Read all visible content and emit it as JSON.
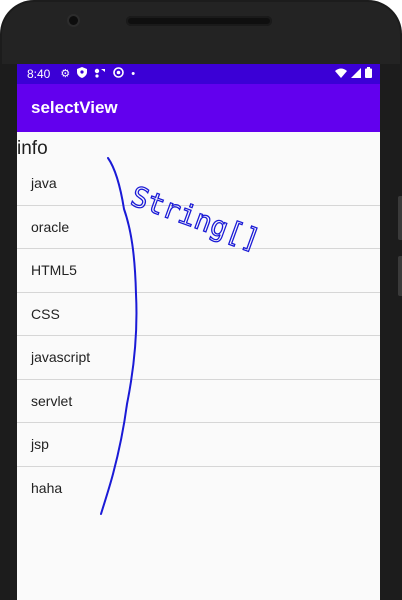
{
  "status_bar": {
    "time": "8:40",
    "icons": [
      "gear-icon",
      "shield-icon",
      "cell-data-icon",
      "at-icon",
      "dot-icon"
    ],
    "right_icons": [
      "wifi-icon",
      "signal-icon",
      "battery-icon"
    ]
  },
  "app_bar": {
    "title": "selectView"
  },
  "section": {
    "title": "info"
  },
  "list": {
    "items": [
      "java",
      "oracle",
      "HTML5",
      "CSS",
      "javascript",
      "servlet",
      "jsp",
      "haha"
    ]
  },
  "annotation": {
    "text": "String[]",
    "color": "#1a1ad6"
  },
  "colors": {
    "status_bar": "#3b00d6",
    "app_bar": "#6200ee",
    "background": "#fafafa",
    "divider": "#d6d6d6"
  }
}
